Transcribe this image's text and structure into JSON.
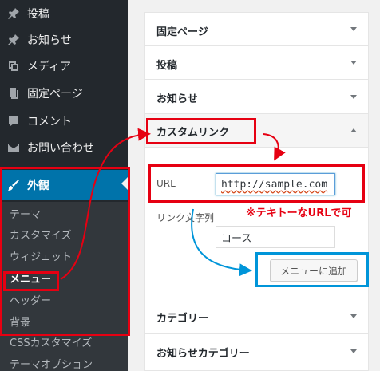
{
  "sidebar": {
    "items": [
      {
        "label": "投稿",
        "icon": "pin-icon"
      },
      {
        "label": "お知らせ",
        "icon": "pin-icon"
      },
      {
        "label": "メディア",
        "icon": "media-icon"
      },
      {
        "label": "固定ページ",
        "icon": "pages-icon"
      },
      {
        "label": "コメント",
        "icon": "comment-icon"
      },
      {
        "label": "お問い合わせ",
        "icon": "mail-icon"
      }
    ],
    "active": {
      "label": "外観",
      "icon": "brush-icon"
    },
    "submenu": [
      "テーマ",
      "カスタマイズ",
      "ウィジェット",
      "メニュー",
      "ヘッダー",
      "背景",
      "CSSカスタマイズ",
      "テーマオプション"
    ]
  },
  "panel": {
    "rows_top": [
      "固定ページ",
      "投稿",
      "お知らせ"
    ],
    "open_section": {
      "title": "カスタムリンク",
      "url_label": "URL",
      "url_value": "http://sample.com",
      "link_text_label": "リンク文字列",
      "link_text_value": "コース",
      "add_button": "メニューに追加"
    },
    "rows_bottom": [
      "カテゴリー",
      "お知らせカテゴリー"
    ]
  },
  "annotations": {
    "note": "※テキトーなURLで可"
  },
  "colors": {
    "sidebar_bg": "#23282d",
    "submenu_bg": "#32373c",
    "active_bg": "#0073aa",
    "annotation_red": "#e60012",
    "annotation_blue": "#0095d9"
  }
}
